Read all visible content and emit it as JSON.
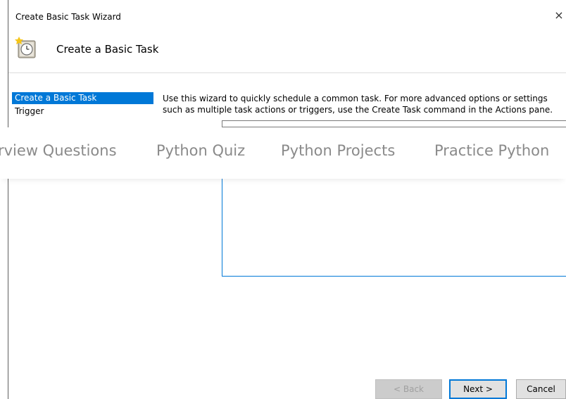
{
  "window": {
    "title": "Create Basic Task Wizard",
    "close_glyph": "×"
  },
  "header": {
    "title": "Create a Basic Task",
    "icon": "task-scheduler-clock-icon"
  },
  "sidebar": {
    "items": [
      {
        "label": "Create a Basic Task",
        "selected": true
      },
      {
        "label": "Trigger",
        "selected": false
      }
    ]
  },
  "main": {
    "description": "Use this wizard to quickly schedule a common task.  For more advanced options or settings such as multiple task actions or triggers, use the Create Task command in the Actions pane."
  },
  "overlay_nav": {
    "links": [
      "rview Questions",
      "Python Quiz",
      "Python Projects",
      "Practice Python"
    ]
  },
  "buttons": {
    "back": "< Back",
    "next": "Next >",
    "cancel": "Cancel"
  },
  "colors": {
    "selection": "#0078d7",
    "overlay_text": "#8a8a8a"
  }
}
